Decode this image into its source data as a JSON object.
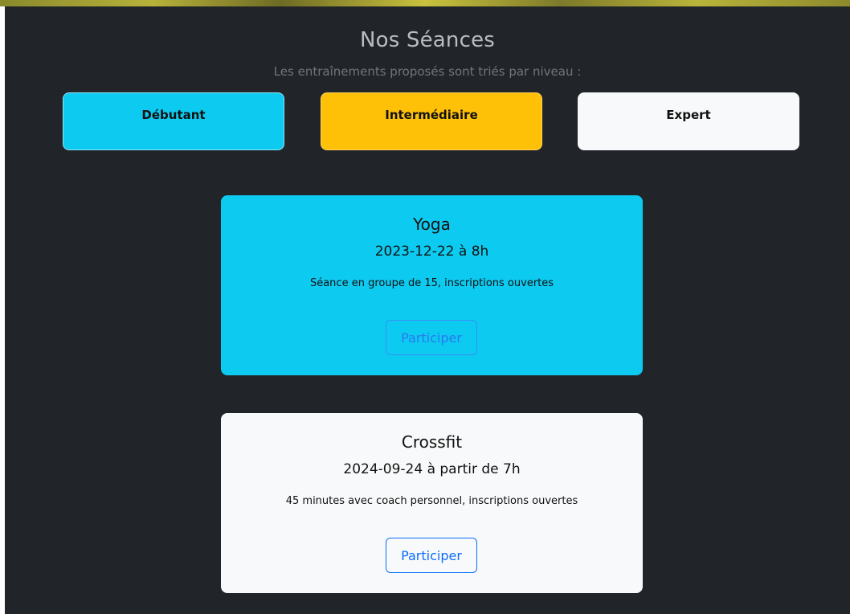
{
  "header": {
    "title": "Nos Séances",
    "subtitle": "Les entraînements proposés sont triés par niveau :"
  },
  "levels": [
    {
      "label": "Débutant",
      "color": "#0dcaf0"
    },
    {
      "label": "Intermédiaire",
      "color": "#ffc107"
    },
    {
      "label": "Expert",
      "color": "#f8f9fa"
    }
  ],
  "sessions": [
    {
      "title": "Yoga",
      "date": "2023-12-22 à 8h",
      "description": "Séance en groupe de 15, inscriptions ouvertes",
      "button_label": "Participer",
      "color": "#0dcaf0"
    },
    {
      "title": "Crossfit",
      "date": "2024-09-24 à partir de 7h",
      "description": "45 minutes avec coach personnel, inscriptions ouvertes",
      "button_label": "Participer",
      "color": "#f8f9fa"
    }
  ],
  "colors": {
    "background": "#212529",
    "accent_blue": "#0d6efd"
  }
}
